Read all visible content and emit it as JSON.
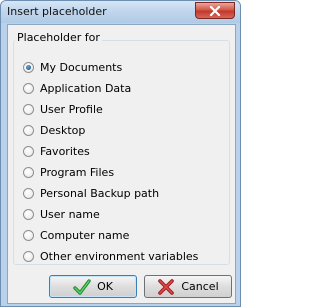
{
  "window": {
    "title": "Insert placeholder"
  },
  "group": {
    "label": "Placeholder for",
    "options": [
      {
        "label": "My Documents",
        "checked": true
      },
      {
        "label": "Application Data",
        "checked": false
      },
      {
        "label": "User Profile",
        "checked": false
      },
      {
        "label": "Desktop",
        "checked": false
      },
      {
        "label": "Favorites",
        "checked": false
      },
      {
        "label": "Program Files",
        "checked": false
      },
      {
        "label": "Personal Backup path",
        "checked": false
      },
      {
        "label": "User name",
        "checked": false
      },
      {
        "label": "Computer name",
        "checked": false
      },
      {
        "label": "Other environment variables",
        "checked": false
      }
    ]
  },
  "buttons": {
    "ok": {
      "label": "OK",
      "icon": "checkmark-icon"
    },
    "cancel": {
      "label": "Cancel",
      "icon": "x-icon"
    }
  }
}
